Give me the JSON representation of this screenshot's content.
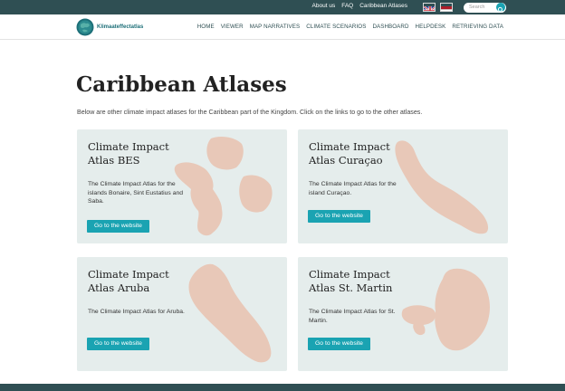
{
  "topbar": {
    "links": [
      "About us",
      "FAQ",
      "Caribbean Atlases"
    ],
    "search_placeholder": "Search"
  },
  "header": {
    "logo_text": "Klimaateffectatlas",
    "nav": [
      "HOME",
      "VIEWER",
      "MAP NARRATIVES",
      "CLIMATE SCENARIOS",
      "DASHBOARD",
      "HELPDESK",
      "RETRIEVING DATA"
    ]
  },
  "main": {
    "title": "Caribbean Atlases",
    "intro": "Below are other climate impact atlases for the Caribbean part of the Kingdom.  Click on the links to go to the other atlases.",
    "cards": [
      {
        "title": "Climate Impact Atlas BES",
        "description": "The Climate Impact Atlas for the islands Bonaire, Sint Eustatius and Saba.",
        "button": "Go to the website"
      },
      {
        "title": "Climate Impact Atlas Curaçao",
        "description": "The Climate Impact Atlas for the island Curaçao.",
        "button": "Go to the website"
      },
      {
        "title": "Climate Impact Atlas Aruba",
        "description": "The Climate Impact Atlas for Aruba.",
        "button": "Go to the website"
      },
      {
        "title": "Climate Impact Atlas St. Martin",
        "description": "The Climate Impact Atlas for St. Martin.",
        "button": "Go to the website"
      }
    ]
  },
  "colors": {
    "dark_teal": "#2f4f53",
    "accent": "#1aa3b2",
    "card_bg": "#e5edec",
    "island": "#e8c8b8"
  },
  "icons": [
    "search-icon",
    "uk-flag-icon",
    "nl-flag-icon",
    "logo-icon"
  ]
}
